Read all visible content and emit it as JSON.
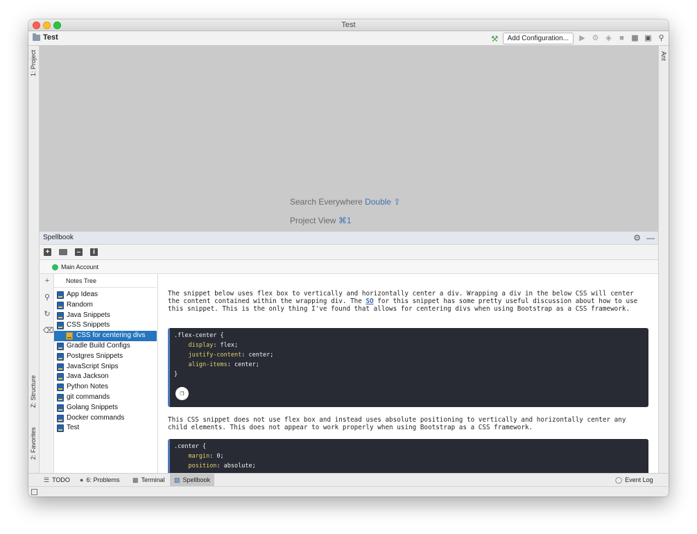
{
  "window": {
    "title": "Test"
  },
  "toolbar": {
    "project_name": "Test",
    "add_configuration_label": "Add Configuration..."
  },
  "side_tabs": {
    "project": "1: Project",
    "structure": "Z: Structure",
    "favorites": "2: Favorites",
    "ant": "Ant"
  },
  "editor_hints": {
    "search_label": "Search Everywhere",
    "search_key": "Double ⇧",
    "project_view_label": "Project View",
    "project_view_key": "⌘1"
  },
  "spellbook": {
    "title": "Spellbook",
    "account": "Main Account",
    "tree_header": "Notes Tree",
    "tree_items": [
      "App Ideas",
      "Random",
      "Java Snippets",
      "CSS Snippets",
      "CSS for centering divs",
      "Gradle Build Configs",
      "Postgres Snippets",
      "JavaScript Snips",
      "Java Jackson",
      "Python Notes",
      "git commands",
      "Golang Snippets",
      "Docker commands",
      "Test"
    ],
    "selected_item": "CSS for centering divs"
  },
  "note": {
    "para1_before_link": "The snippet below uses flex box to vertically and horizontally center a div. Wrapping a div in the below CSS will center the content contained within the wrapping div. The ",
    "para1_link": "SO",
    "para1_after_link": " for this snippet has some pretty useful discussion about how to use this snippet. This is the only thing I've found that allows for centering divs when using Bootstrap as a CSS framework.",
    "code1": {
      "line1": ".flex-center {",
      "p1_name": "display",
      "p1_value": ": flex;",
      "p2_name": "justify-content",
      "p2_value": ": center;",
      "p3_name": "align-items",
      "p3_value": ": center;",
      "close": "}"
    },
    "para2": "This CSS snippet does not use flex box and instead uses absolute positioning to vertically and horizontally center any child elements. This does not appear to work properly when using Bootstrap as a CSS framework.",
    "code2": {
      "line1": ".center {",
      "p1_name": "margin",
      "p1_value": ": 0;",
      "p2_name": "position",
      "p2_value": ": absolute;"
    }
  },
  "bottom_tabs": {
    "todo": "TODO",
    "problems": "6: Problems",
    "terminal": "Terminal",
    "spellbook": "Spellbook",
    "event_log": "Event Log"
  }
}
